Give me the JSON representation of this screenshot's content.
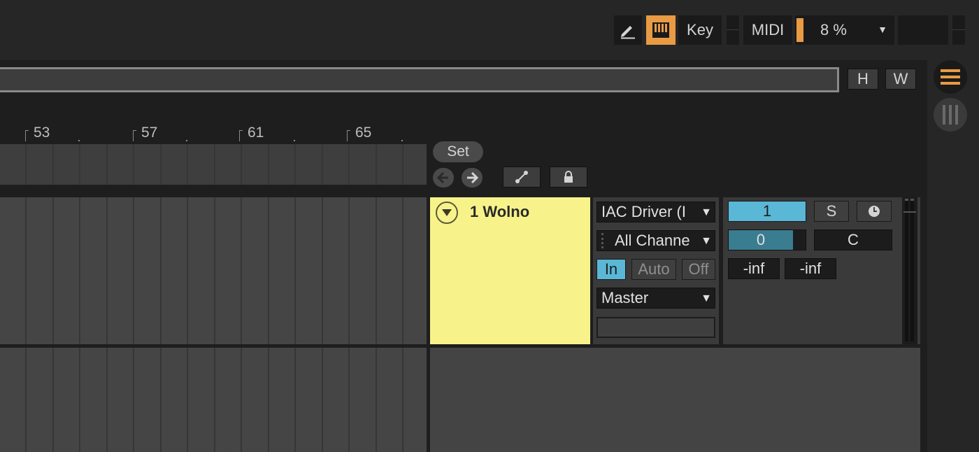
{
  "toolbar": {
    "key_label": "Key",
    "midi_label": "MIDI",
    "cpu_value": "8 %",
    "cpu_dropdown_arrow": "▼"
  },
  "zoom": {
    "h_label": "H",
    "w_label": "W"
  },
  "ruler": {
    "bars": [
      "53",
      "57",
      "61",
      "65"
    ]
  },
  "locators": {
    "set_label": "Set"
  },
  "track": {
    "name": "1 Wolno",
    "color": "#f7f38a",
    "input_type": "IAC Driver (I",
    "input_channel": "All Channe",
    "monitor": {
      "in_label": "In",
      "auto_label": "Auto",
      "off_label": "Off",
      "selected": "In"
    },
    "output": "Master",
    "track_number": "1",
    "solo_label": "S",
    "pan_value": "0",
    "pan_label": "C",
    "peak_left": "-inf",
    "peak_right": "-inf"
  },
  "colors": {
    "accent": "#e89b43",
    "active_blue": "#5ab7d6",
    "panel": "#1e1e1e",
    "lane": "#454545"
  },
  "icons": {
    "pencil": "pencil-icon",
    "keyboard": "piano-keyboard-icon",
    "menu": "hamburger-menu-icon",
    "columns": "columns-icon",
    "fold": "fold-arrow-icon",
    "back": "arrow-left-icon",
    "forward": "arrow-right-icon",
    "link": "link-icon",
    "lock": "lock-icon",
    "clock": "clock-icon"
  }
}
